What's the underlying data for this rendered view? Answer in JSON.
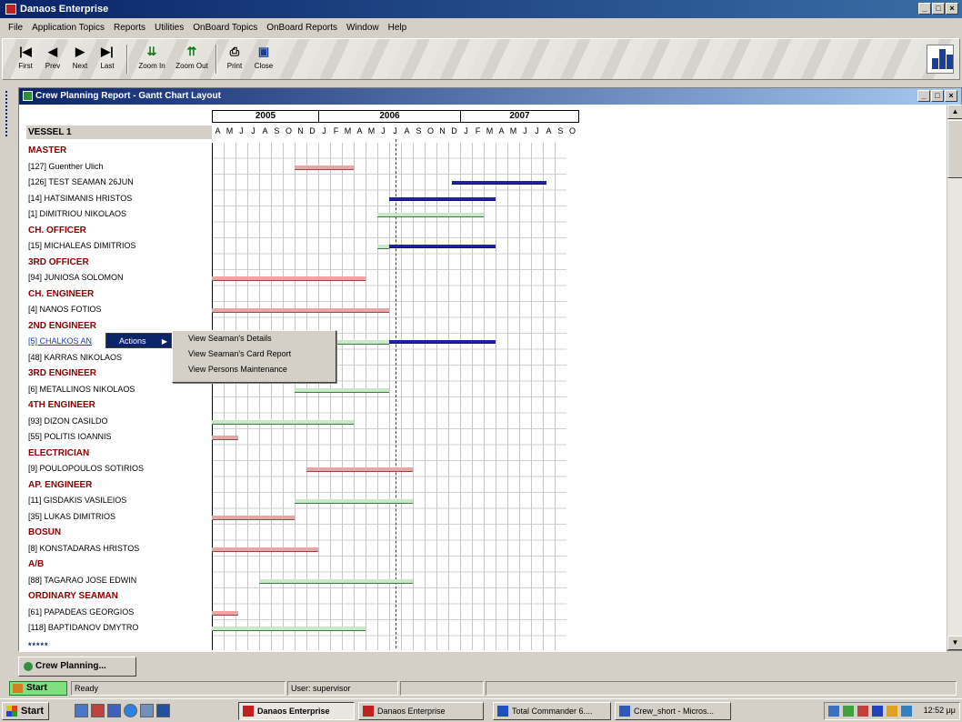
{
  "window": {
    "title": "Danaos Enterprise",
    "buttons": [
      "_",
      "□",
      "×"
    ]
  },
  "menu": [
    "File",
    "Application Topics",
    "Reports",
    "Utilities",
    "OnBoard Topics",
    "OnBoard Reports",
    "Window",
    "Help"
  ],
  "toolbar": {
    "first": "First",
    "prev": "Prev",
    "next": "Next",
    "last": "Last",
    "zoom_in": "Zoom In",
    "zoom_out": "Zoom Out",
    "print": "Print",
    "close": "Close"
  },
  "child": {
    "title": "Crew Planning Report - Gantt Chart Layout",
    "vessel": "VESSEL 1",
    "years": [
      "2005",
      "2006",
      "2007"
    ],
    "months": [
      "A",
      "M",
      "J",
      "J",
      "A",
      "S",
      "O",
      "N",
      "D",
      "J",
      "F",
      "M",
      "A",
      "M",
      "J",
      "J",
      "A",
      "S",
      "O",
      "N",
      "D",
      "J",
      "F",
      "M",
      "A",
      "M",
      "J",
      "J",
      "A",
      "S",
      "O"
    ],
    "rows": [
      {
        "label": "MASTER",
        "type": "cat"
      },
      {
        "label": "[127] Guenther Ulich",
        "bars": [
          {
            "start": 7,
            "len": 5,
            "color": "pink"
          }
        ]
      },
      {
        "label": "[126] TEST SEAMAN 26JUN",
        "bars": [
          {
            "start": 20.3,
            "len": 8,
            "color": "blue"
          }
        ]
      },
      {
        "label": "[14] HATSIMANIS HRISTOS",
        "bars": [
          {
            "start": 15,
            "len": 9,
            "color": "blue"
          }
        ]
      },
      {
        "label": "[1] DIMITRIOU NIKOLAOS",
        "bars": [
          {
            "start": 14,
            "len": 9,
            "color": "green"
          }
        ]
      },
      {
        "label": "CH. OFFICER",
        "type": "cat"
      },
      {
        "label": "[15] MICHALEAS DIMITRIOS",
        "bars": [
          {
            "start": 14,
            "len": 1,
            "color": "green"
          },
          {
            "start": 15,
            "len": 9,
            "color": "blue"
          }
        ]
      },
      {
        "label": "3RD OFFICER",
        "type": "cat"
      },
      {
        "label": "[94] JUNIOSA SOLOMON",
        "bars": [
          {
            "start": 0,
            "len": 13,
            "color": "pink"
          }
        ]
      },
      {
        "label": "CH. ENGINEER",
        "type": "cat"
      },
      {
        "label": "[4] NANOS FOTIOS",
        "bars": [
          {
            "start": 0,
            "len": 15,
            "color": "pink"
          }
        ]
      },
      {
        "label": "2ND ENGINEER",
        "type": "cat"
      },
      {
        "label": "[5] CHALKOS AN",
        "link": true,
        "bars": [
          {
            "start": 10,
            "len": 5,
            "color": "green"
          },
          {
            "start": 15,
            "len": 9,
            "color": "blue"
          }
        ]
      },
      {
        "label": "[48] KARRAS NIKOLAOS",
        "bars": []
      },
      {
        "label": "3RD ENGINEER",
        "type": "cat"
      },
      {
        "label": "[6] METALLINOS NIKOLAOS",
        "bars": [
          {
            "start": 7,
            "len": 8,
            "color": "green"
          }
        ]
      },
      {
        "label": "4TH ENGINEER",
        "type": "cat"
      },
      {
        "label": "[93] DIZON CASILDO",
        "bars": [
          {
            "start": 0,
            "len": 12,
            "color": "green"
          }
        ]
      },
      {
        "label": "[55] POLITIS IOANNIS",
        "bars": [
          {
            "start": 0,
            "len": 2.2,
            "color": "pink"
          }
        ]
      },
      {
        "label": "ELECTRICIAN",
        "type": "cat"
      },
      {
        "label": "[9] POULOPOULOS SOTIRIOS",
        "bars": [
          {
            "start": 8,
            "len": 9,
            "color": "pink"
          }
        ]
      },
      {
        "label": "AP. ENGINEER",
        "type": "cat"
      },
      {
        "label": "[11] GISDAKIS VASILEIOS",
        "bars": [
          {
            "start": 7,
            "len": 10,
            "color": "green"
          }
        ]
      },
      {
        "label": "[35] LUKAS DIMITRIOS",
        "bars": [
          {
            "start": 0,
            "len": 7,
            "color": "pink"
          }
        ]
      },
      {
        "label": "BOSUN",
        "type": "cat"
      },
      {
        "label": "[8] KONSTADARAS HRISTOS",
        "bars": [
          {
            "start": 0,
            "len": 9,
            "color": "pink"
          }
        ]
      },
      {
        "label": "A/B",
        "type": "cat"
      },
      {
        "label": "[88] TAGARAO JOSE EDWIN",
        "bars": [
          {
            "start": 4,
            "len": 13,
            "color": "green"
          }
        ]
      },
      {
        "label": "ORDINARY SEAMAN",
        "type": "cat"
      },
      {
        "label": "[61] PAPADEAS GEORGIOS",
        "bars": [
          {
            "start": 0,
            "len": 2.2,
            "color": "pink"
          }
        ]
      },
      {
        "label": "[118] BAPTIDANOV DMYTRO",
        "bars": [
          {
            "start": 0,
            "len": 13,
            "color": "green"
          }
        ]
      }
    ],
    "today_month_index": 15.5,
    "stars": "*****"
  },
  "context_menu": {
    "actions_label": "Actions",
    "items": [
      "View Seaman's Details",
      "View Seaman's Card Report",
      "View Persons Maintenance"
    ]
  },
  "tab": {
    "label": "Crew Planning..."
  },
  "status": {
    "start": "Start",
    "state": "Ready",
    "user": "User: supervisor"
  },
  "taskbar": {
    "start": "Start",
    "tasks": [
      "Danaos Enterprise",
      "Danaos Enterprise",
      "Total Commander 6....",
      "Crew_short - Micros..."
    ],
    "clock": "12:52 μμ"
  }
}
